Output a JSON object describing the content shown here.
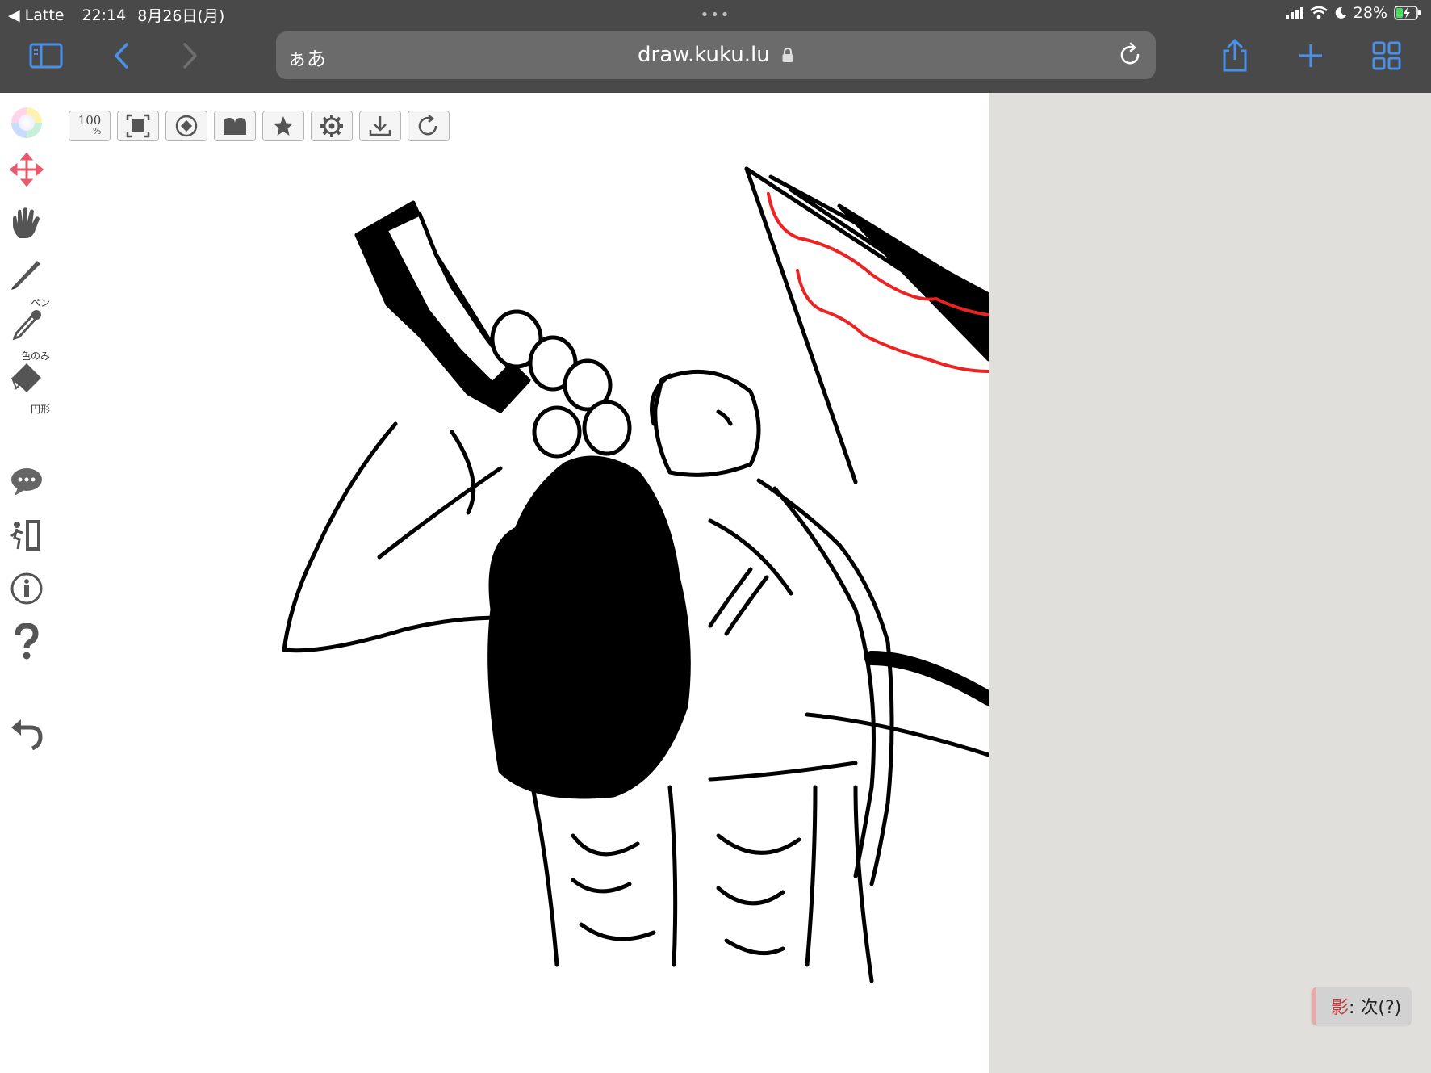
{
  "status_bar": {
    "back_app": "◀ Latte",
    "time": "22:14",
    "date": "8月26日(月)",
    "dots": "•••",
    "battery": "28%"
  },
  "browser": {
    "reader_label": "ぁあ",
    "url": "draw.kuku.lu"
  },
  "top_toolbar": {
    "zoom_label_top": "100",
    "zoom_label_bottom": "%",
    "tools": [
      "zoom-100",
      "fit-screen",
      "rotate-canvas",
      "layers",
      "favorite",
      "settings",
      "download",
      "refresh"
    ]
  },
  "side_toolbar": {
    "items": [
      {
        "id": "color",
        "caption": ""
      },
      {
        "id": "move",
        "caption": ""
      },
      {
        "id": "hand",
        "caption": ""
      },
      {
        "id": "pen",
        "caption": "ペン"
      },
      {
        "id": "eyedropper",
        "caption": "色のみ"
      },
      {
        "id": "eraser",
        "caption": "円形"
      },
      {
        "id": "chat",
        "caption": ""
      },
      {
        "id": "exit",
        "caption": ""
      },
      {
        "id": "info",
        "caption": ""
      },
      {
        "id": "help",
        "caption": ""
      },
      {
        "id": "undo",
        "caption": ""
      }
    ]
  },
  "hint": {
    "accent": "影",
    "text": ": 次(?)"
  },
  "colors": {
    "chrome": "#494949",
    "address_bar": "#6b6b6b",
    "accent_blue": "#4a8fe8",
    "canvas_bg": "#ffffff",
    "page_bg": "#e0dfdc",
    "stroke_black": "#000000",
    "stroke_red": "#ee2222"
  }
}
